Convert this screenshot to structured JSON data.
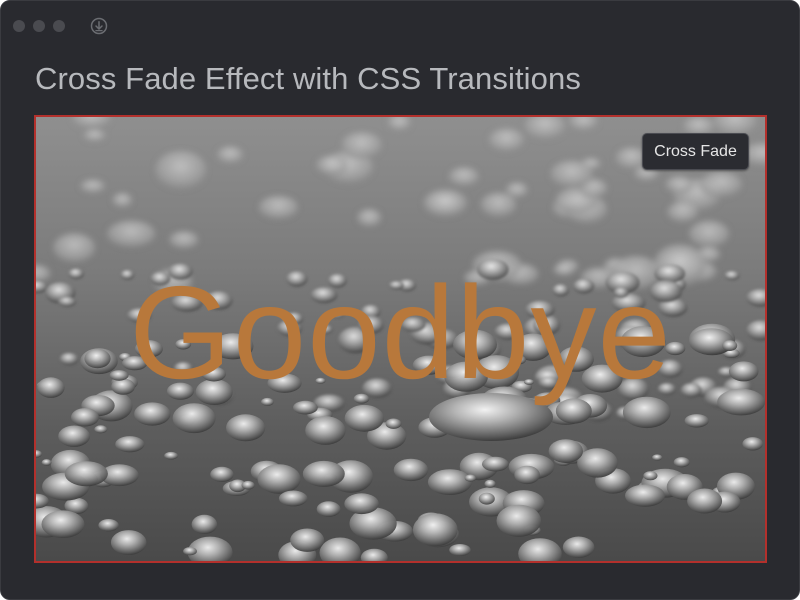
{
  "window": {
    "background": "#292a2f",
    "controls": [
      "close",
      "minimize",
      "zoom"
    ],
    "toolbar_icon": "download-circle-icon"
  },
  "page": {
    "title": "Cross Fade Effect with CSS Transitions"
  },
  "stage": {
    "border_color": "#b3302c",
    "image": "water-droplets-grayscale-photo",
    "overlay_text": "Goodbye",
    "overlay_color": "#b8783b",
    "button_label": "Cross Fade"
  }
}
